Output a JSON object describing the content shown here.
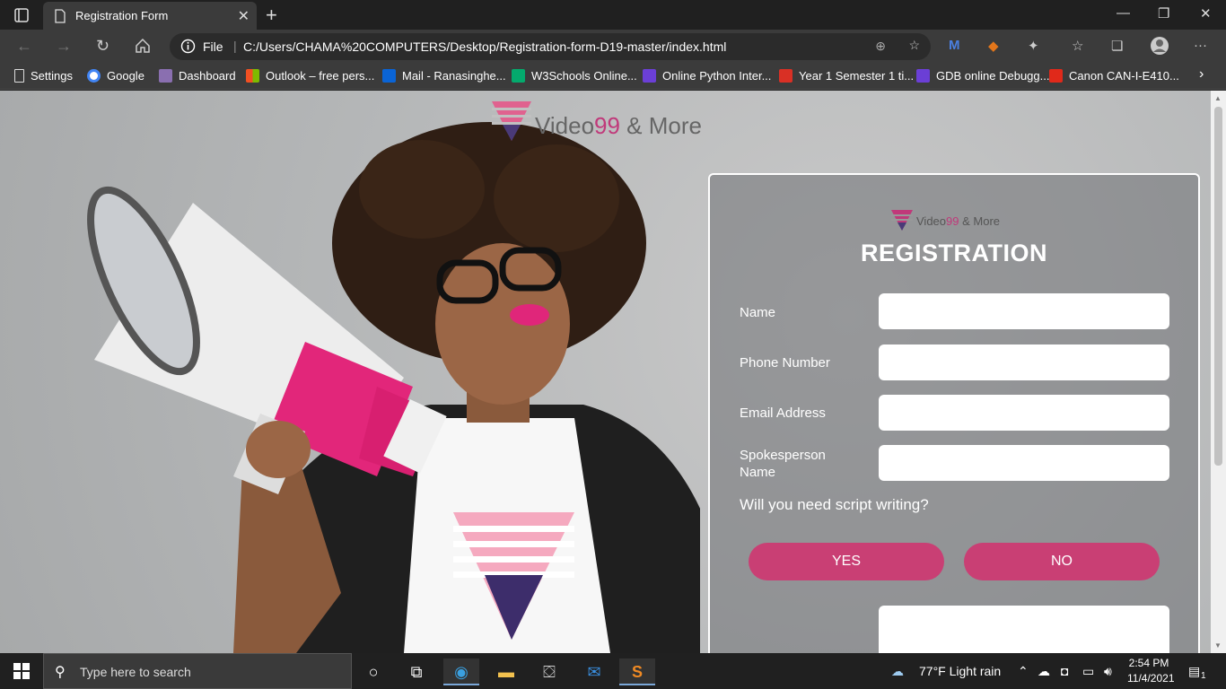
{
  "browser": {
    "tab_title": "Registration Form",
    "address_label": "File",
    "url": "C:/Users/CHAMA%20COMPUTERS/Desktop/Registration-form-D19-master/index.html",
    "bookmarks": [
      {
        "label": "Settings",
        "icon": "page-icon",
        "color": "#dddddd"
      },
      {
        "label": "Google",
        "icon": "google-icon",
        "color": "#4285f4"
      },
      {
        "label": "Dashboard",
        "icon": "dashboard-icon",
        "color": "#8a6fb0"
      },
      {
        "label": "Outlook – free pers...",
        "icon": "microsoft-icon",
        "color": "#f25022"
      },
      {
        "label": "Mail - Ranasinghe...",
        "icon": "outlook-icon",
        "color": "#0a64d6"
      },
      {
        "label": "W3Schools Online...",
        "icon": "w3schools-icon",
        "color": "#04aa6d"
      },
      {
        "label": "Online Python Inter...",
        "icon": "replit-icon",
        "color": "#6b3fd6"
      },
      {
        "label": "Year 1 Semester 1 ti...",
        "icon": "gmail-icon",
        "color": "#d93025"
      },
      {
        "label": "GDB online Debugg...",
        "icon": "gdb-icon",
        "color": "#6b3fd6"
      },
      {
        "label": "Canon CAN-I-E410...",
        "icon": "canon-icon",
        "color": "#e0291a"
      }
    ]
  },
  "page": {
    "brand_left": "Video",
    "brand_accent": "99",
    "brand_right": " & More",
    "form": {
      "title": "REGISTRATION",
      "fields": [
        {
          "label": "Name",
          "value": ""
        },
        {
          "label": "Phone Number",
          "value": ""
        },
        {
          "label": "Email Address",
          "value": ""
        },
        {
          "label": "Spokesperson Name",
          "value": ""
        }
      ],
      "question": "Will you need script writing?",
      "yes_label": "YES",
      "no_label": "NO"
    },
    "colors": {
      "accent": "#c93f74",
      "brand_pink": "#c0397a"
    }
  },
  "taskbar": {
    "search_placeholder": "Type here to search",
    "weather": "77°F  Light rain",
    "time": "2:54 PM",
    "date": "11/4/2021",
    "notification_count": "1"
  }
}
